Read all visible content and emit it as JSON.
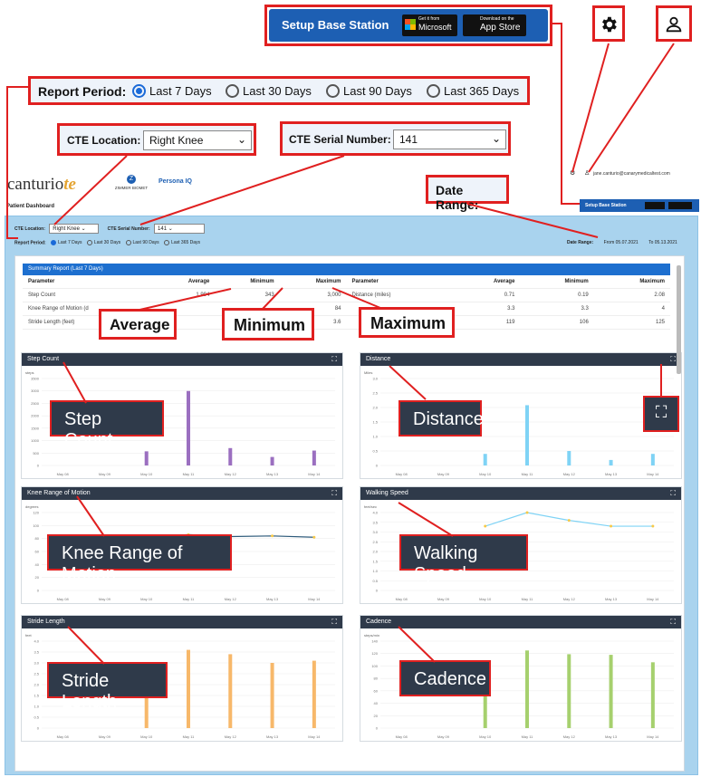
{
  "setup": {
    "label": "Setup Base Station",
    "store1_small": "Get it from",
    "store1": "Microsoft",
    "store2_small": "Download on the",
    "store2": "App Store"
  },
  "icons": {
    "gear": "gear-icon",
    "user": "user-icon"
  },
  "callouts": {
    "report_period": "Report Period:",
    "periods": [
      "Last 7 Days",
      "Last 30 Days",
      "Last 90 Days",
      "Last 365 Days"
    ],
    "cte_location_label": "CTE Location:",
    "cte_location_value": "Right Knee",
    "cte_serial_label": "CTE Serial Number:",
    "cte_serial_value": "141",
    "date_range": "Date Range:",
    "average": "Average",
    "minimum": "Minimum",
    "maximum": "Maximum",
    "step_count": "Step Count",
    "distance": "Distance",
    "knee_rom": "Knee Range of Motion",
    "walking_speed": "Walking Speed",
    "stride_length": "Stride Length",
    "cadence": "Cadence"
  },
  "brand": {
    "canturio": "canturio",
    "zimmer": "ZIMMER BIOMET",
    "persona": "Persona IQ",
    "dashboard": "Patient Dashboard"
  },
  "topright": {
    "email": "jane.canturio@canarymedicaltest.com",
    "setup_small": "Setup Base Station"
  },
  "filters": {
    "cte_location_label": "CTE Location:",
    "cte_location_value": "Right Knee",
    "cte_serial_label": "CTE Serial Number:",
    "cte_serial_value": "141",
    "report_period_label": "Report Period:",
    "periods": [
      "Last 7 Days",
      "Last 30 Days",
      "Last 90 Days",
      "Last 365 Days"
    ],
    "date_range_label": "Date Range:",
    "from_label": "From",
    "from": "05.07.2021",
    "to_label": "To",
    "to": "05.13.2021"
  },
  "summary": {
    "title": "Summary Report (Last 7 Days)",
    "headers_left": [
      "Parameter",
      "Average",
      "Minimum",
      "Maximum"
    ],
    "headers_right": [
      "Parameter",
      "Average",
      "Minimum",
      "Maximum"
    ],
    "rows_left": [
      [
        "Step Count",
        "1,994",
        "343",
        "3,000"
      ],
      [
        "Knee Range of Motion (d",
        "",
        "",
        "84"
      ],
      [
        "Stride Length (feet)",
        "",
        "",
        "3.6"
      ]
    ],
    "rows_right": [
      [
        "Distance (miles)",
        "0.71",
        "0.19",
        "2.08"
      ],
      [
        "",
        "3.3",
        "3.3",
        "4"
      ],
      [
        "",
        "119",
        "106",
        "125"
      ]
    ]
  },
  "charts": {
    "x_labels": [
      "May 08",
      "May 09",
      "May 10",
      "May 11",
      "May 12",
      "May 13",
      "May 14"
    ],
    "step_count": {
      "title": "Step Count",
      "unit": "steps",
      "yticks": [
        "3500",
        "3000",
        "2500",
        "2000",
        "1500",
        "1000",
        "500",
        "0"
      ]
    },
    "distance": {
      "title": "Distance",
      "unit": "Miles",
      "yticks": [
        "3.0",
        "2.5",
        "2.0",
        "1.5",
        "1.0",
        "0.5",
        "0"
      ]
    },
    "knee_rom": {
      "title": "Knee Range of Motion",
      "unit": "degrees",
      "yticks": [
        "120",
        "100",
        "80",
        "60",
        "40",
        "20",
        "0"
      ]
    },
    "walking_speed": {
      "title": "Walking Speed",
      "unit": "feet/sec",
      "yticks": [
        "4.0",
        "3.5",
        "3.0",
        "2.5",
        "2.0",
        "1.5",
        "1.0",
        "0.5",
        "0"
      ]
    },
    "stride_length": {
      "title": "Stride Length",
      "unit": "feet",
      "yticks": [
        "4.0",
        "3.5",
        "3.0",
        "2.5",
        "2.0",
        "1.5",
        "1.0",
        "0.5",
        "0"
      ]
    },
    "cadence": {
      "title": "Cadence",
      "unit": "steps/min",
      "yticks": [
        "140",
        "120",
        "100",
        "80",
        "60",
        "40",
        "20",
        "0"
      ]
    }
  },
  "chart_data": [
    {
      "type": "bar",
      "title": "Step Count",
      "categories": [
        "May 08",
        "May 09",
        "May 10",
        "May 11",
        "May 12",
        "May 13",
        "May 14"
      ],
      "values": [
        0,
        0,
        570,
        3000,
        700,
        343,
        600
      ],
      "ylim": [
        0,
        3500
      ],
      "color": "#9b6fc0"
    },
    {
      "type": "bar",
      "title": "Distance",
      "categories": [
        "May 08",
        "May 09",
        "May 10",
        "May 11",
        "May 12",
        "May 13",
        "May 14"
      ],
      "values": [
        0,
        0,
        0.4,
        2.08,
        0.5,
        0.19,
        0.4
      ],
      "ylim": [
        0,
        3.0
      ],
      "color": "#7fd3f5"
    },
    {
      "type": "line",
      "title": "Knee Range of Motion",
      "categories": [
        "May 08",
        "May 09",
        "May 10",
        "May 11",
        "May 12",
        "May 13",
        "May 14"
      ],
      "values": [
        null,
        null,
        82,
        86,
        83,
        84,
        82
      ],
      "ylim": [
        0,
        120
      ],
      "color": "#2d5a7a"
    },
    {
      "type": "line",
      "title": "Walking Speed",
      "categories": [
        "May 08",
        "May 09",
        "May 10",
        "May 11",
        "May 12",
        "May 13",
        "May 14"
      ],
      "values": [
        null,
        null,
        3.3,
        4.0,
        3.6,
        3.3,
        3.3
      ],
      "ylim": [
        0,
        4.0
      ],
      "color": "#7fd3f5"
    },
    {
      "type": "bar",
      "title": "Stride Length",
      "categories": [
        "May 08",
        "May 09",
        "May 10",
        "May 11",
        "May 12",
        "May 13",
        "May 14"
      ],
      "values": [
        0,
        0,
        3.0,
        3.6,
        3.4,
        3.0,
        3.1
      ],
      "ylim": [
        0,
        4.0
      ],
      "color": "#f7b86a"
    },
    {
      "type": "bar",
      "title": "Cadence",
      "categories": [
        "May 08",
        "May 09",
        "May 10",
        "May 11",
        "May 12",
        "May 13",
        "May 14"
      ],
      "values": [
        0,
        0,
        106,
        125,
        119,
        118,
        106
      ],
      "ylim": [
        0,
        140
      ],
      "color": "#a6d06e"
    }
  ]
}
